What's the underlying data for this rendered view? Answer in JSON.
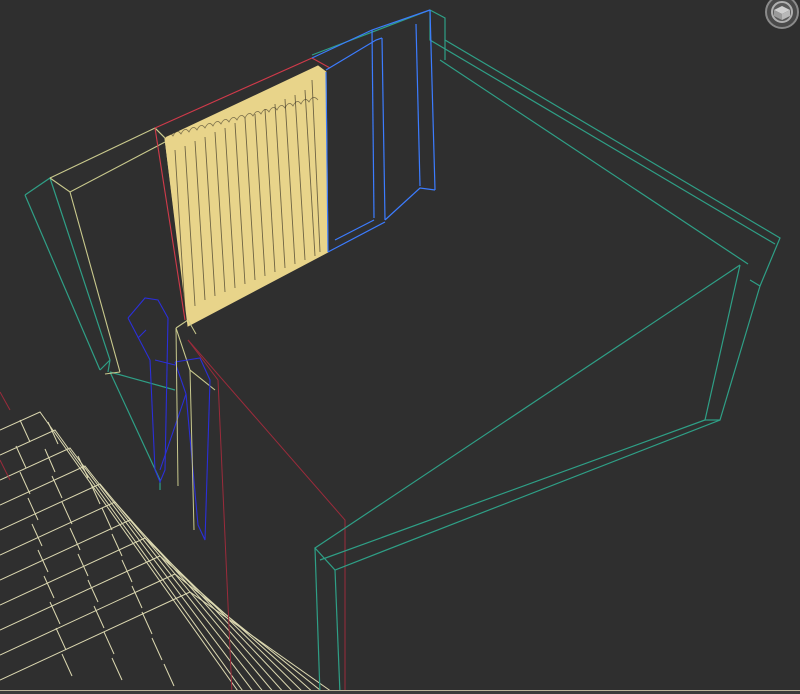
{
  "viewport": {
    "background": "#2f2f2f",
    "mode": "wireframe"
  },
  "colors": {
    "room_shell": "#2f9f86",
    "wall_left": "#c9c98d",
    "wall_blue": "#3c7cff",
    "curtain_fill": "#e8d48a",
    "curtain_stroke": "#3b3426",
    "curtain_frame": "#d03a4a",
    "chair": "#2b2fd9",
    "floor_tiles": "#e6e2b8",
    "red_wire": "#9b2b3b"
  },
  "icons": {
    "viewcube": "viewcube-icon"
  }
}
